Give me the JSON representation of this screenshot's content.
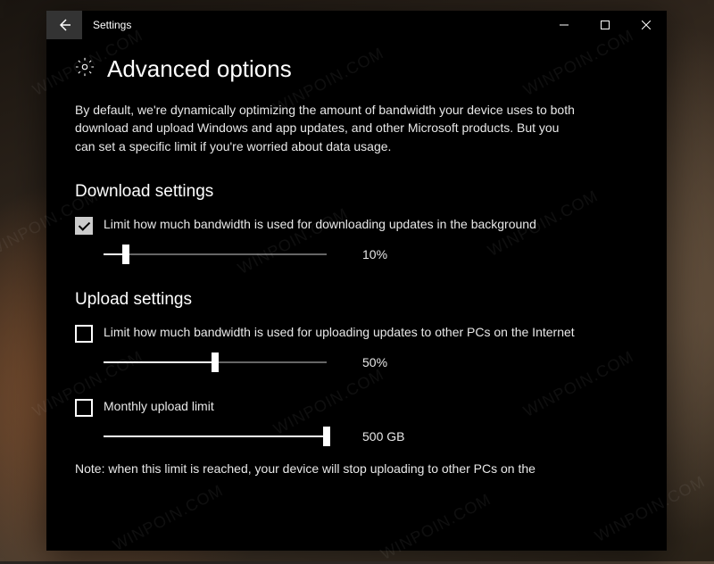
{
  "window": {
    "title": "Settings"
  },
  "page": {
    "heading": "Advanced options",
    "description": "By default, we're dynamically optimizing the amount of bandwidth your device uses to both download and upload Windows and app updates, and other Microsoft products. But you can set a specific limit if you're worried about data usage."
  },
  "download": {
    "heading": "Download settings",
    "limit_label": "Limit how much bandwidth is used for downloading updates in the background",
    "limit_checked": true,
    "slider_percent": 10,
    "slider_display": "10%"
  },
  "upload": {
    "heading": "Upload settings",
    "limit_label": "Limit how much bandwidth is used for uploading updates to other PCs on the Internet",
    "limit_checked": false,
    "slider_percent": 50,
    "slider_display": "50%",
    "monthly_label": "Monthly upload limit",
    "monthly_checked": false,
    "monthly_slider_percent": 100,
    "monthly_display": "500 GB"
  },
  "note": "Note: when this limit is reached, your device will stop uploading to other PCs on the",
  "watermark_text": "WINPOIN.COM"
}
